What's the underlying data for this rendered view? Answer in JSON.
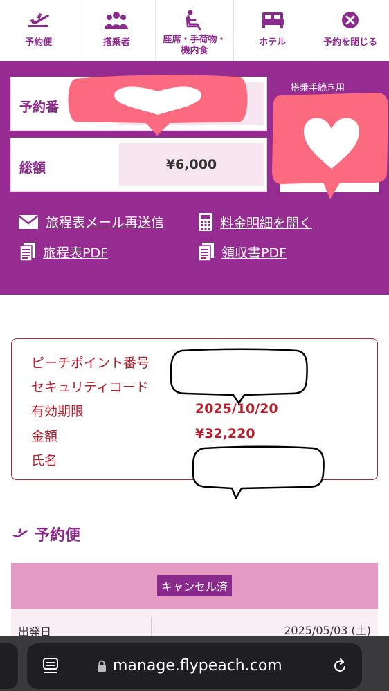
{
  "nav": {
    "items": [
      {
        "label": "予約便",
        "icon": "plane-icon"
      },
      {
        "label": "搭乗者",
        "icon": "people-icon"
      },
      {
        "label": "座席・手荷物・機内食",
        "line1": "座席・手荷物・",
        "line2": "機内食",
        "icon": "seat-icon"
      },
      {
        "label": "ホテル",
        "icon": "bed-icon"
      },
      {
        "label": "予約を閉じる",
        "icon": "close-circle-icon"
      }
    ]
  },
  "summary": {
    "reservation_label": "予約番",
    "total_label": "総額",
    "total_value": "¥6,000",
    "checkin_label": "搭乗手続き用"
  },
  "actions": {
    "resend_email": "旅程表メール再送信",
    "open_fare": "料金明細を開く",
    "itinerary_pdf": "旅程表PDF",
    "receipt_pdf": "領収書PDF"
  },
  "point_card": {
    "rows": [
      {
        "label": "ピーチポイント番号",
        "value": ""
      },
      {
        "label": "セキュリティコード",
        "value": ""
      },
      {
        "label": "有効期限",
        "value": "2025/10/20"
      },
      {
        "label": "金額",
        "value": "¥32,220"
      },
      {
        "label": "氏名",
        "value": ""
      }
    ]
  },
  "flight": {
    "section_title": "予約便",
    "status_badge": "キャンセル済",
    "departure_label": "出発日",
    "departure_value": "2025/05/03 (土)"
  },
  "browser": {
    "url": "manage.flypeach.com"
  },
  "colors": {
    "brand_purple": "#962c92",
    "accent_red": "#b81f2d",
    "header_pink": "#e49ac2"
  }
}
